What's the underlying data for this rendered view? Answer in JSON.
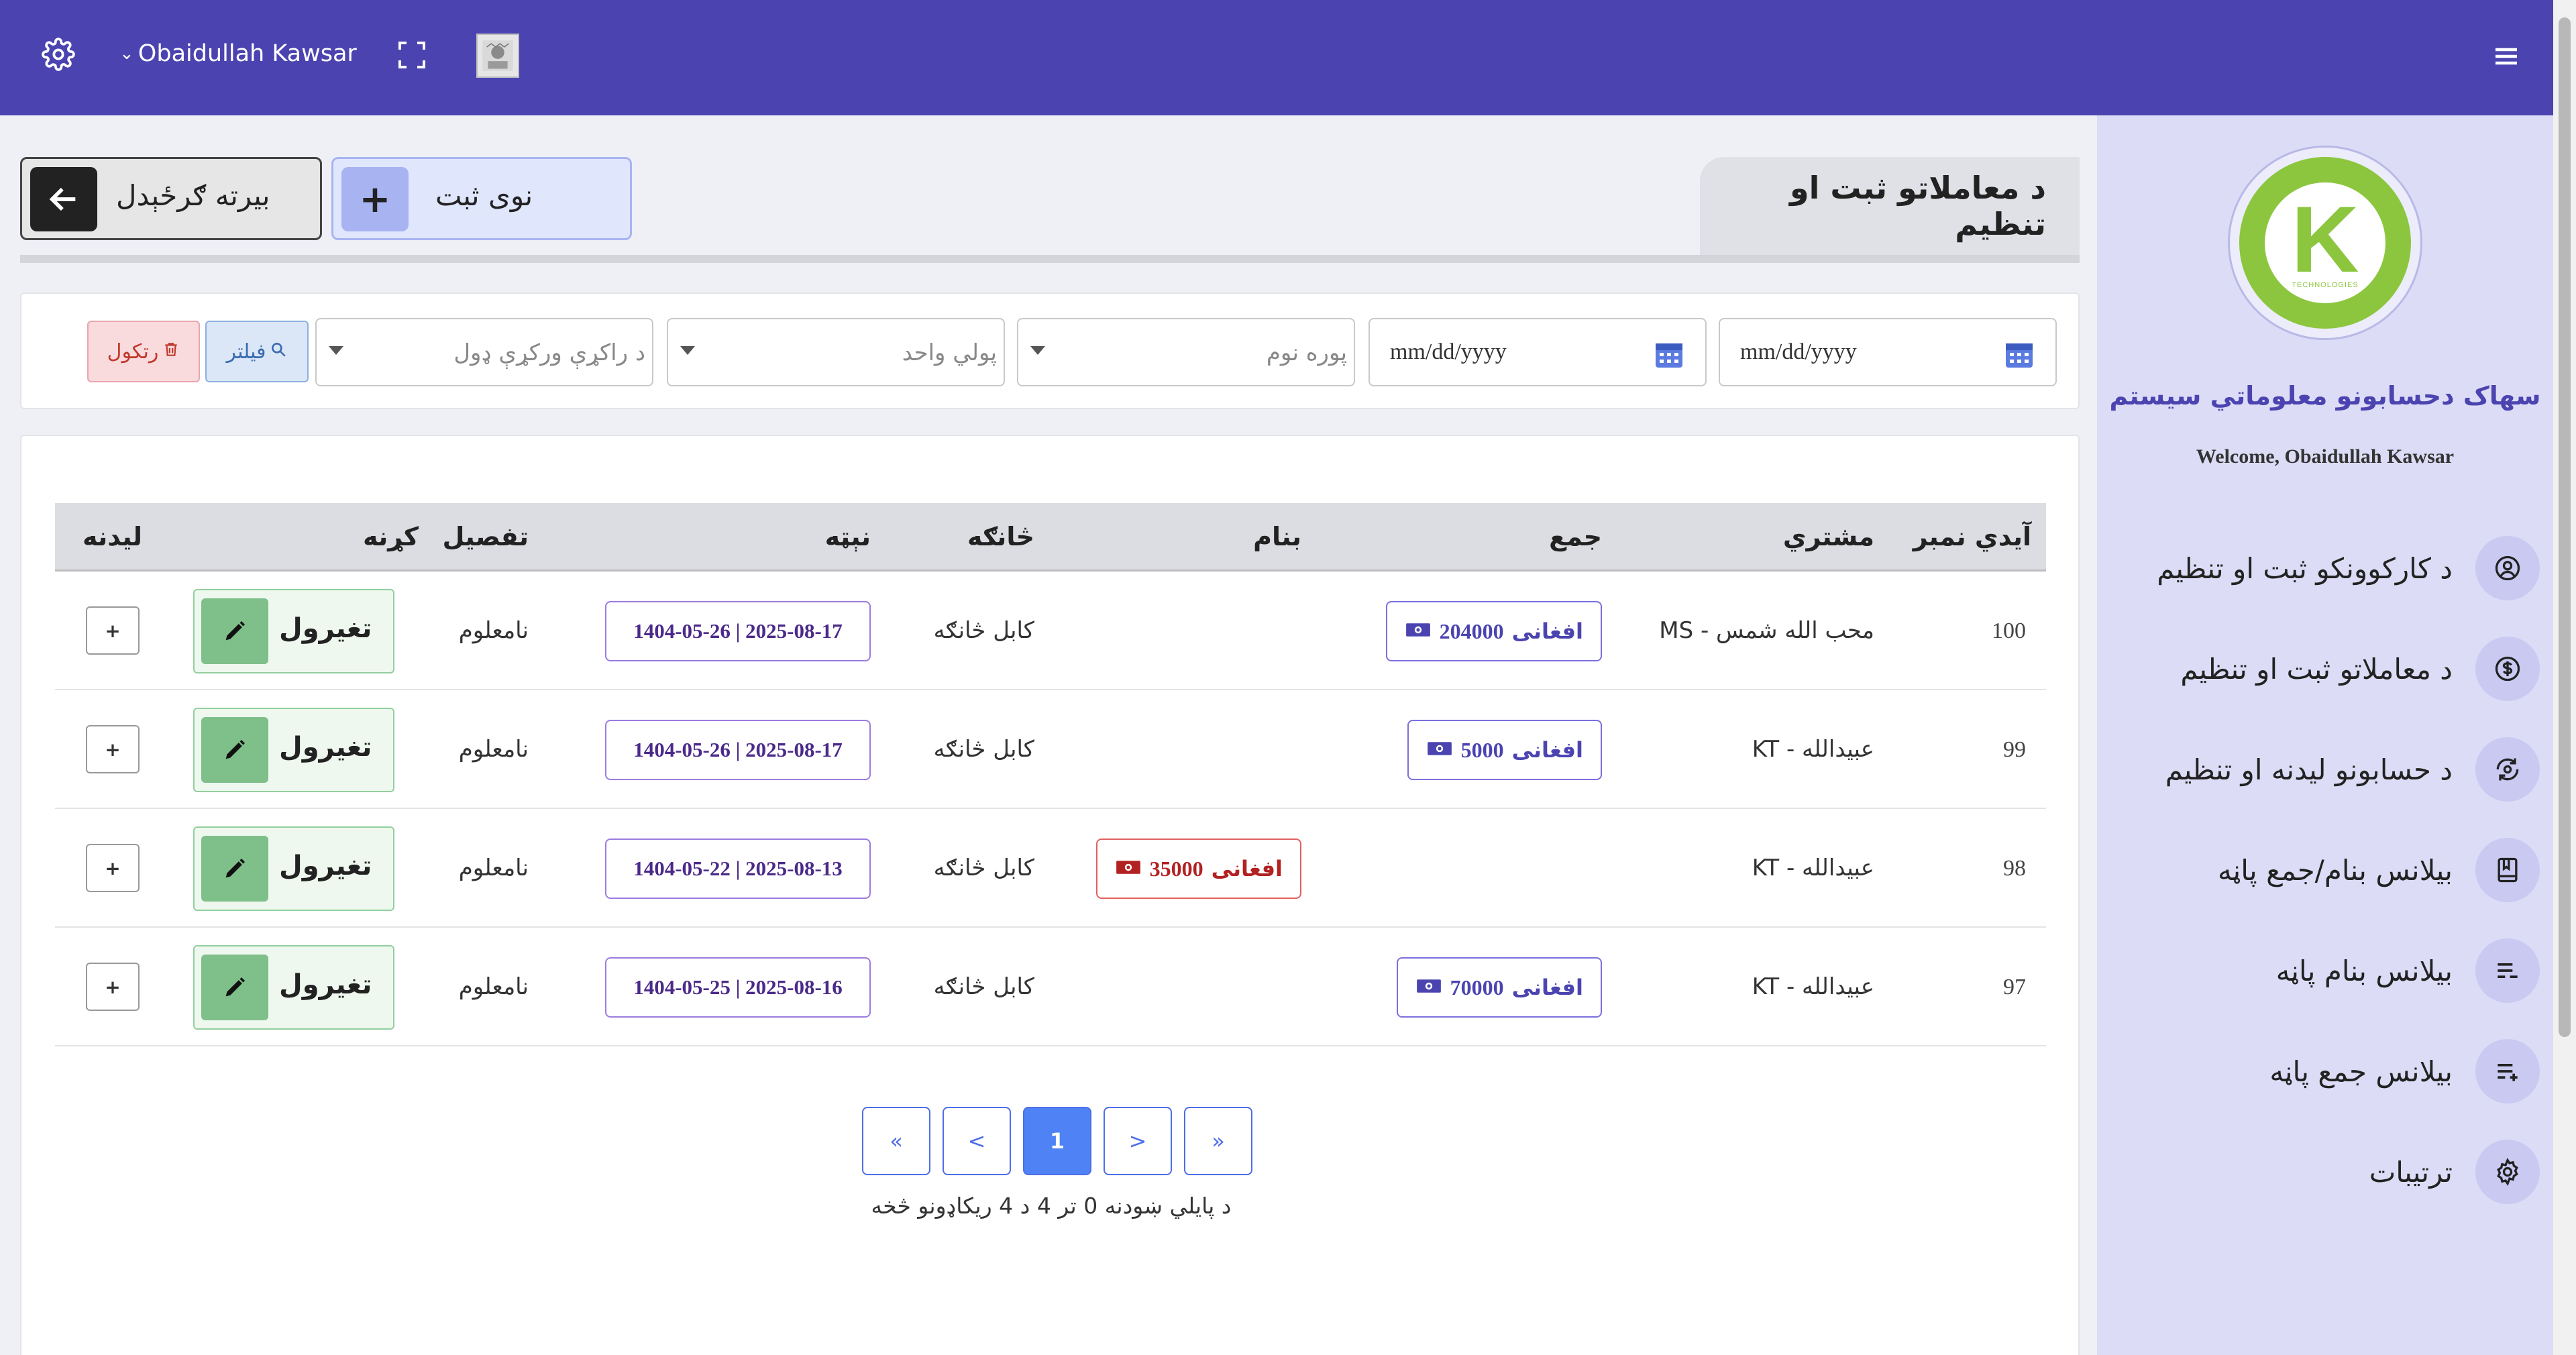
{
  "topbar": {
    "user_name": "Obaidullah Kawsar",
    "icons": [
      "gear-icon",
      "chevron-down-icon",
      "fullscreen-icon",
      "avatar",
      "menu-icon"
    ]
  },
  "sidebar": {
    "logo_letter": "K",
    "logo_sub": "TECHNOLOGIES",
    "system_title": "سهاک دحسابونو معلوماتي سیستم",
    "welcome": "Welcome, Obaidullah Kawsar",
    "items": [
      {
        "label": "د کارکوونکو ثبت او تنظیم",
        "icon": "user-circle-icon"
      },
      {
        "label": "د معاملاتو ثبت او تنظیم",
        "icon": "dollar-circle-icon"
      },
      {
        "label": "د حسابونو لیدنه او تنظیم",
        "icon": "refresh-account-icon"
      },
      {
        "label": "بیلانس بنام/جمع پاڼه",
        "icon": "book-icon"
      },
      {
        "label": "بیلانس بنام پاڼه",
        "icon": "list-minus-icon"
      },
      {
        "label": "بیلانس جمع پاڼه",
        "icon": "list-plus-icon"
      },
      {
        "label": "ترتیبات",
        "icon": "gear-icon"
      }
    ]
  },
  "main": {
    "back_label": "بیرته ګرځېدل",
    "new_label": "نوی ثبت",
    "page_title": "د معاملاتو ثبت او تنظیم",
    "filters": {
      "date_from_placeholder": "mm/dd/yyyy",
      "date_to_placeholder": "mm/dd/yyyy",
      "full_name_placeholder": "پوره نوم",
      "currency_placeholder": "پولي واحد",
      "transaction_type_placeholder": "د راکړې ورکړې ډول",
      "filter_label": "فیلتر",
      "cancel_label": "رتکول"
    },
    "table": {
      "headers": {
        "id": "آیدي نمبر",
        "customer": "مشتري",
        "credit": "جمع",
        "debit": "بنام",
        "branch": "څانګه",
        "date": "نېټه",
        "details": "تفصیل",
        "action": "کړنه",
        "view": "لیدنه"
      },
      "rows": [
        {
          "id": "100",
          "customer": "محب الله شمس - MS",
          "credit": "204000",
          "debit": "",
          "currency": "افغانی",
          "branch": "کابل څانګه",
          "date": "1404-05-26 | 2025-08-17",
          "details": "نامعلوم",
          "edit_label": "تغیرول",
          "plus_label": "+"
        },
        {
          "id": "99",
          "customer": "عبیدالله - KT",
          "credit": "5000",
          "debit": "",
          "currency": "افغانی",
          "branch": "کابل څانګه",
          "date": "1404-05-26 | 2025-08-17",
          "details": "نامعلوم",
          "edit_label": "تغیرول",
          "plus_label": "+"
        },
        {
          "id": "98",
          "customer": "عبیدالله - KT",
          "credit": "",
          "debit": "35000",
          "currency": "افغانی",
          "branch": "کابل څانګه",
          "date": "1404-05-22 | 2025-08-13",
          "details": "نامعلوم",
          "edit_label": "تغیرول",
          "plus_label": "+"
        },
        {
          "id": "97",
          "customer": "عبیدالله - KT",
          "credit": "70000",
          "debit": "",
          "currency": "افغانی",
          "branch": "کابل څانګه",
          "date": "1404-05-25 | 2025-08-16",
          "details": "نامعلوم",
          "edit_label": "تغیرول",
          "plus_label": "+"
        }
      ]
    },
    "pagination": {
      "first": "«",
      "prev": "<",
      "current": "1",
      "next": ">",
      "last": "»",
      "info": "د پایلي ښودنه 0 تر 4 د 4 ریکاډونو څخه"
    }
  },
  "colors": {
    "topbar": "#4b44b0",
    "sidebar": "#dcdcf6",
    "logo_green": "#8cc63f",
    "credit_border": "#7b6fe0",
    "debit_border": "#e06060"
  }
}
